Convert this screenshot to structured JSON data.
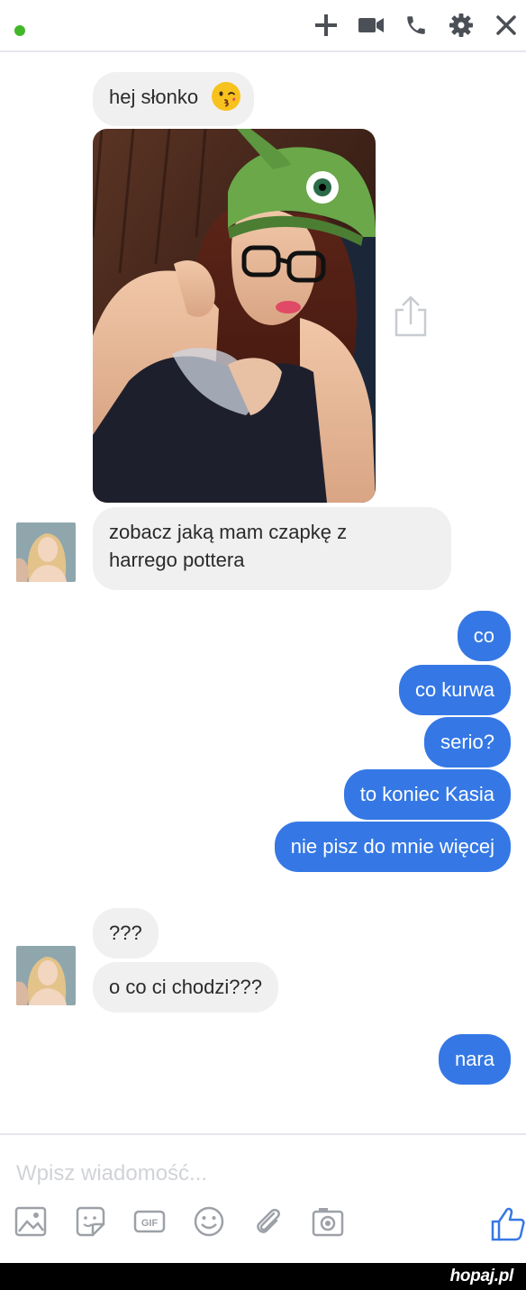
{
  "header": {
    "status_color": "#42b72a",
    "icons": [
      "add-icon",
      "video-camera-icon",
      "phone-icon",
      "gear-icon",
      "close-icon"
    ]
  },
  "messages": [
    {
      "sender": "other",
      "text": "hej słonko",
      "emoji": "kissing-face"
    },
    {
      "sender": "other",
      "type": "photo"
    },
    {
      "sender": "other",
      "lines": [
        "zobacz jaką mam czapkę z",
        "harrego pottera"
      ]
    },
    {
      "sender": "me",
      "text": "co"
    },
    {
      "sender": "me",
      "text": "co kurwa"
    },
    {
      "sender": "me",
      "text": "serio?"
    },
    {
      "sender": "me",
      "text": "to koniec Kasia"
    },
    {
      "sender": "me",
      "text": "nie pisz do mnie więcej"
    },
    {
      "sender": "other",
      "text": "???"
    },
    {
      "sender": "other",
      "text": "o co ci chodzi???"
    },
    {
      "sender": "me",
      "text": "nara"
    }
  ],
  "composer": {
    "placeholder": "Wpisz wiadomość...",
    "tools": [
      "photo-icon",
      "sticker-icon",
      "gif-icon",
      "emoji-icon",
      "attachment-icon",
      "camera-icon"
    ],
    "like_icon": "thumbs-up-icon"
  },
  "colors": {
    "sent_bubble": "#3578e5",
    "received_bubble": "#f1f0f0",
    "accent": "#3578e5"
  },
  "footer": {
    "logo": "hopaj.pl"
  }
}
